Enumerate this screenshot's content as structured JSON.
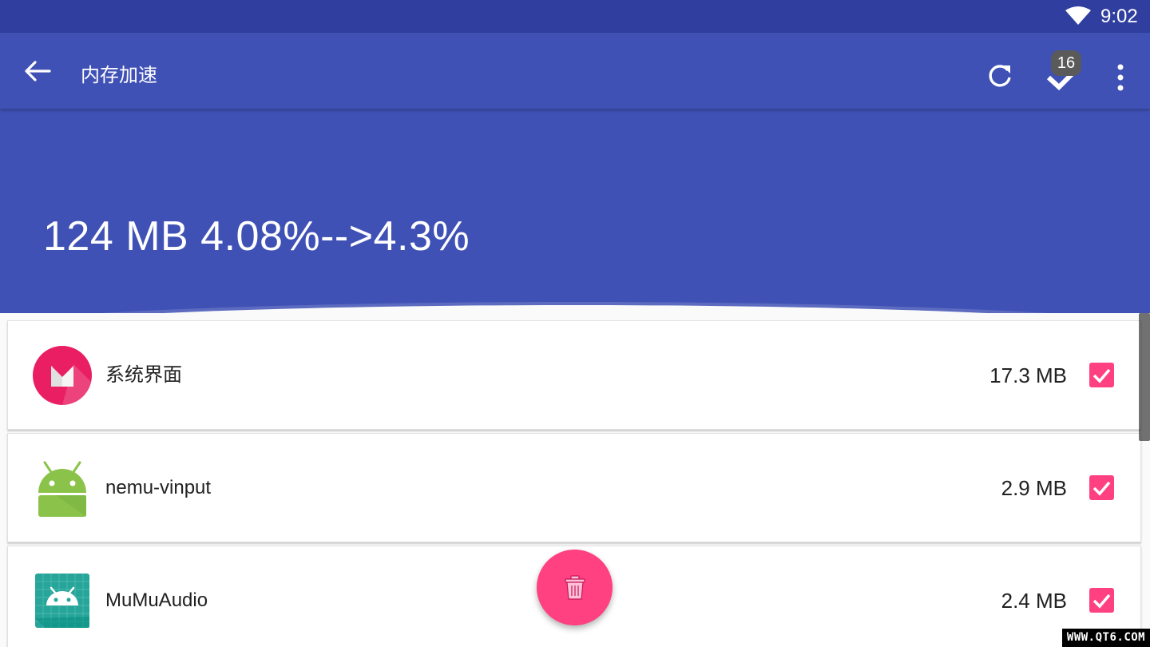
{
  "status_bar": {
    "time": "9:02",
    "wifi_icon": "wifi-icon"
  },
  "toolbar": {
    "title": "内存加速",
    "back_icon": "arrow-back-icon",
    "refresh_icon": "refresh-icon",
    "select_all_icon": "check-icon",
    "selected_count_badge": "16",
    "more_icon": "more-vert-icon"
  },
  "header": {
    "stats_text": "124 MB 4.08%-->4.3%"
  },
  "apps": [
    {
      "name": "系统界面",
      "size": "17.3 MB",
      "checked": true,
      "icon": "marshmallow-icon"
    },
    {
      "name": "nemu-vinput",
      "size": "2.9 MB",
      "checked": true,
      "icon": "android-icon"
    },
    {
      "name": "MuMuAudio",
      "size": "2.4 MB",
      "checked": true,
      "icon": "android-grid-icon"
    }
  ],
  "fab": {
    "icon": "trash-icon"
  },
  "watermark": "WWW.QT6.COM",
  "colors": {
    "primary": "#3f51b5",
    "primary_dark": "#303f9f",
    "accent": "#ff4081"
  }
}
